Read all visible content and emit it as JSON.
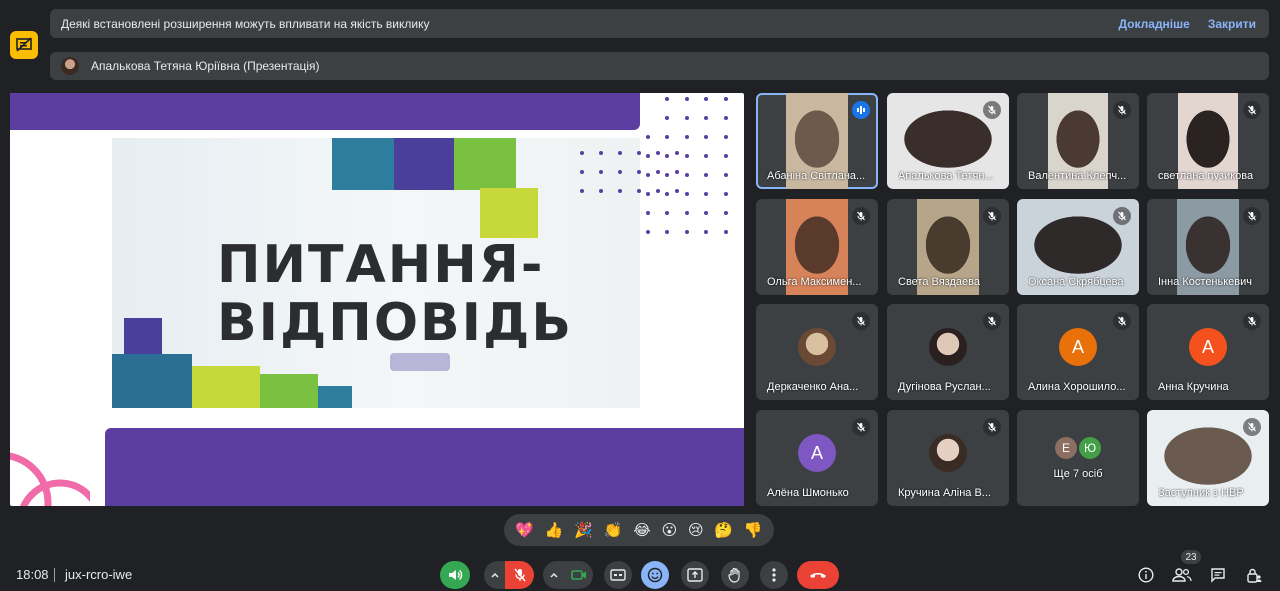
{
  "notice": {
    "text": "Деякі встановлені розширення можуть впливати на якість виклику",
    "learn_more": "Докладніше",
    "close": "Закрити"
  },
  "presenter": {
    "label": "Апалькова Тетяна Юріївна (Презентація)"
  },
  "slide": {
    "line1": "ПИТАННЯ-",
    "line2": "ВІДПОВІДЬ"
  },
  "participants": [
    {
      "name": "Абаніна Світлана...",
      "state": "speaking"
    },
    {
      "name": "Апалькова Тетян...",
      "state": "muted"
    },
    {
      "name": "Валентина Клепч...",
      "state": "muted"
    },
    {
      "name": "светлана пузикова",
      "state": "muted"
    },
    {
      "name": "Ольга Максимен...",
      "state": "muted"
    },
    {
      "name": "Света Вяздаева",
      "state": "muted"
    },
    {
      "name": "Оксана Скрябцева",
      "state": "muted"
    },
    {
      "name": "Інна Костенькевич",
      "state": "muted"
    },
    {
      "name": "Деркаченко Ана...",
      "state": "muted"
    },
    {
      "name": "Дугінова Руслан...",
      "state": "muted"
    },
    {
      "name": "Алина Хорошило...",
      "initial": "А",
      "color": "#e8710a",
      "state": "muted"
    },
    {
      "name": "Анна Кручина",
      "initial": "А",
      "color": "#f4511e",
      "state": "muted"
    },
    {
      "name": "Алёна Шмонько",
      "initial": "А",
      "color": "#7e57c2",
      "state": "muted"
    },
    {
      "name": "Кручина Аліна В...",
      "state": "muted"
    },
    {
      "name": "Ще 7 осіб",
      "initials": [
        "Е",
        "Ю"
      ]
    },
    {
      "name": "Заступник з НВР",
      "state": "muted"
    }
  ],
  "reactions": [
    "💖",
    "👍",
    "🎉",
    "👏",
    "😂",
    "😮",
    "😢",
    "🤔",
    "👎"
  ],
  "footer": {
    "time": "18:08",
    "meeting_code": "jux-rcro-iwe",
    "participant_count": "23"
  },
  "colors": {
    "accent_purple": "#5b3fa0",
    "speaking_border": "#8ab4f8",
    "end_call": "#ea4335",
    "audio_on": "#34a853"
  }
}
